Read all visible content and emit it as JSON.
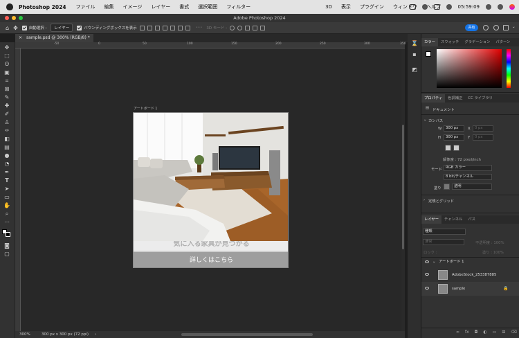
{
  "menubar": {
    "app": "Photoshop 2024",
    "items": [
      "ファイル",
      "編集",
      "イメージ",
      "レイヤー",
      "書式",
      "選択範囲",
      "フィルター",
      "3D",
      "表示",
      "プラグイン",
      "ウィンドウ",
      "ヘルプ"
    ],
    "clock": "05:59:09"
  },
  "window": {
    "title": "Adobe Photoshop 2024"
  },
  "options": {
    "auto_select": "自動選択 :",
    "layer_select": "レイヤー",
    "bounding_box": "バウンディングボックスを表示",
    "mode_3d": "3D モード :",
    "share": "共有"
  },
  "document": {
    "tab": "sample.psd @ 300% (RGB/8) *",
    "close": "×"
  },
  "ruler": {
    "ticks": [
      "-50",
      "0",
      "50",
      "100",
      "150",
      "200",
      "250",
      "300",
      "350"
    ]
  },
  "artboard": {
    "label": "アートボード 1",
    "banner_text": "気に入る家具が見つかる",
    "cta": "詳しくはこちら"
  },
  "status": {
    "zoom": "300%",
    "size": "300 px x 300 px (72 ppi)",
    "arrow": "›"
  },
  "color_panel": {
    "tabs": [
      "カラー",
      "スウォッチ",
      "グラデーション",
      "パターン"
    ]
  },
  "properties_panel": {
    "tabs": [
      "プロパティ",
      "色調補正",
      "CC ライブラリ"
    ],
    "doc_label": "ドキュメント",
    "canvas": "カンバス",
    "w_label": "W",
    "w_value": "300 px",
    "h_label": "H",
    "h_value": "300 px",
    "x_label": "X",
    "x_value": "0 px",
    "y_label": "Y",
    "y_value": "0 px",
    "resolution": "解像度 : 72 pixel/inch",
    "mode_label": "モード",
    "mode_value": "RGB カラー",
    "depth_value": "8 bit/チャンネル",
    "fill_label": "塗り",
    "fill_value": "透明",
    "guides": "定規とグリッド"
  },
  "layers_panel": {
    "tabs": [
      "レイヤー",
      "チャンネル",
      "パス"
    ],
    "filter": "種類",
    "blend": "通常",
    "opacity": "不透明度 : 100%",
    "lock": "ロック :",
    "fill": "塗り : 100%",
    "layers": [
      {
        "name": "アートボード 1"
      },
      {
        "name": "AdobeStock_253387885"
      },
      {
        "name": "sample"
      }
    ]
  }
}
